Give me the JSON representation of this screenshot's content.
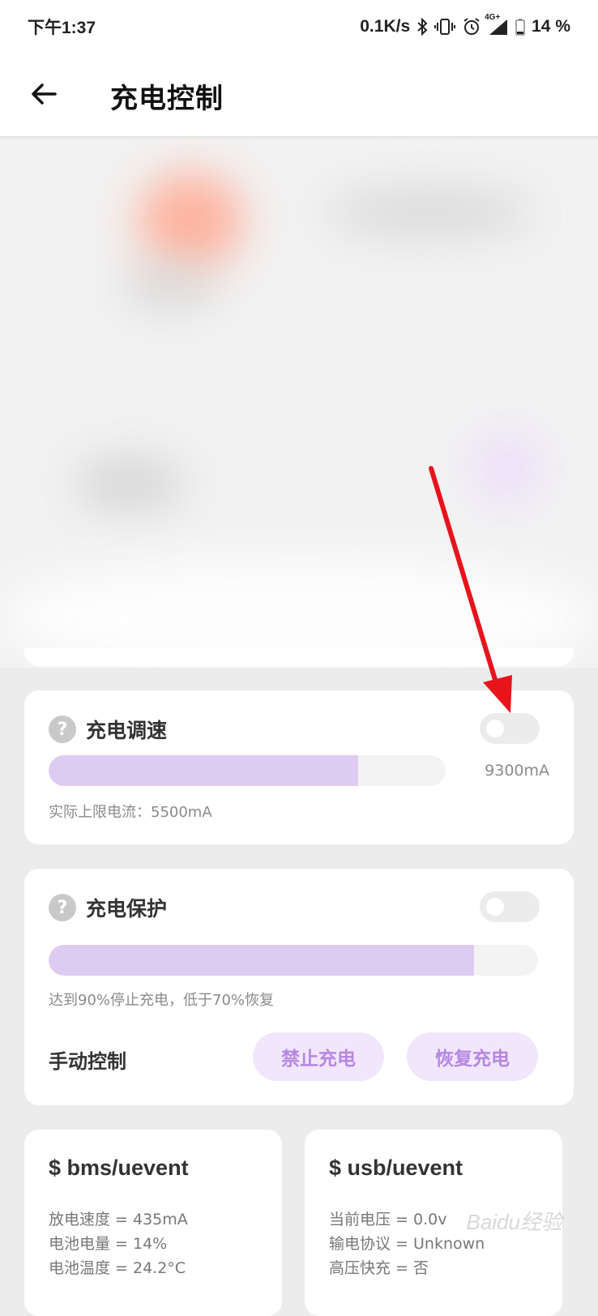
{
  "status_bar": {
    "time": "下午1:37",
    "net_speed": "0.1K/s",
    "battery_text": "14 %",
    "icons": [
      "bluetooth-icon",
      "vibrate-icon",
      "alarm-icon",
      "signal-4g-icon",
      "battery-icon"
    ],
    "network_label": "4G+"
  },
  "app_bar": {
    "title": "充电控制",
    "back_icon": "arrow-left-icon"
  },
  "charge_speed": {
    "title": "充电调速",
    "value": "9300mA",
    "fill_fraction": 0.78,
    "actual_limit": "实际上限电流：5500mA",
    "toggle_on": false
  },
  "charge_protect": {
    "title": "充电保护",
    "fill_fraction": 0.87,
    "note": "达到90%停止充电，低于70%恢复",
    "toggle_on": false,
    "manual_label": "手动控制",
    "stop_button": "禁止充电",
    "resume_button": "恢复充电"
  },
  "bms_card": {
    "title": "$ bms/uevent",
    "lines": [
      "放电速度 = 435mA",
      "电池电量 = 14%",
      "电池温度 = 24.2°C"
    ]
  },
  "usb_card": {
    "title": "$ usb/uevent",
    "lines": [
      "当前电压 = 0.0v",
      "输电协议 = Unknown",
      "高压快充 = 否"
    ]
  },
  "watermark": "Baidu经验",
  "colors": {
    "accent_fill": "#decbf1",
    "pill_bg": "#f1e6fc",
    "pill_text": "#b588e3",
    "annotation_arrow": "#e8141c"
  }
}
